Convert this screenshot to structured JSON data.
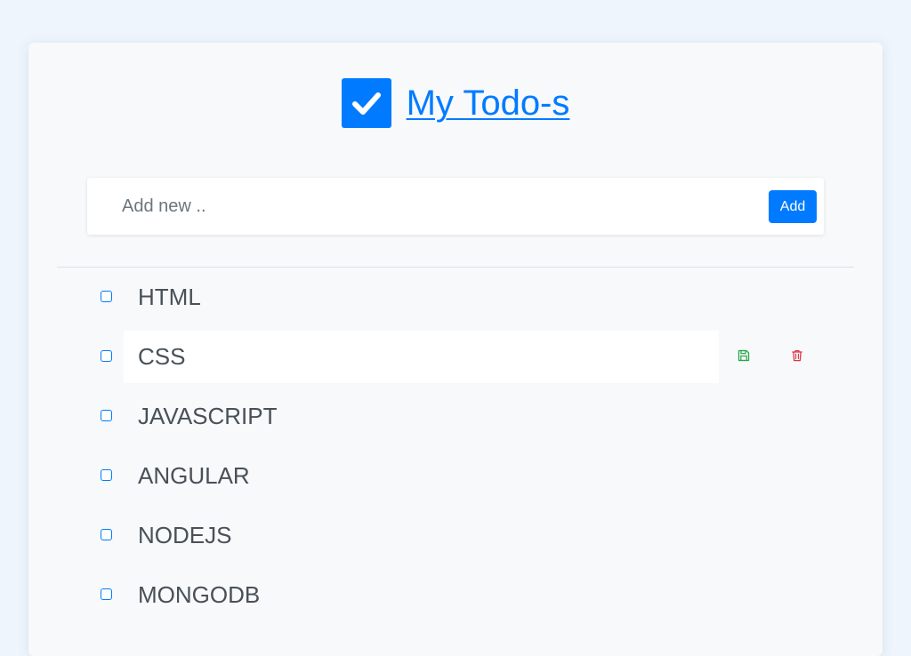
{
  "header": {
    "title": "My Todo-s",
    "logo_icon": "check-square-icon"
  },
  "add_form": {
    "placeholder": "Add new ..",
    "value": "",
    "button_label": "Add"
  },
  "todos": [
    {
      "label": "HTML",
      "completed": false,
      "editing": false
    },
    {
      "label": "CSS",
      "completed": false,
      "editing": true,
      "actions": [
        "save-icon",
        "trash-icon"
      ]
    },
    {
      "label": "JAVASCRIPT",
      "completed": false,
      "editing": false
    },
    {
      "label": "ANGULAR",
      "completed": false,
      "editing": false
    },
    {
      "label": "NODEJS",
      "completed": false,
      "editing": false
    },
    {
      "label": "MONGODB",
      "completed": false,
      "editing": false
    }
  ],
  "colors": {
    "primary": "#007bff",
    "save": "#28a745",
    "delete": "#dc3545",
    "text": "#495057"
  }
}
